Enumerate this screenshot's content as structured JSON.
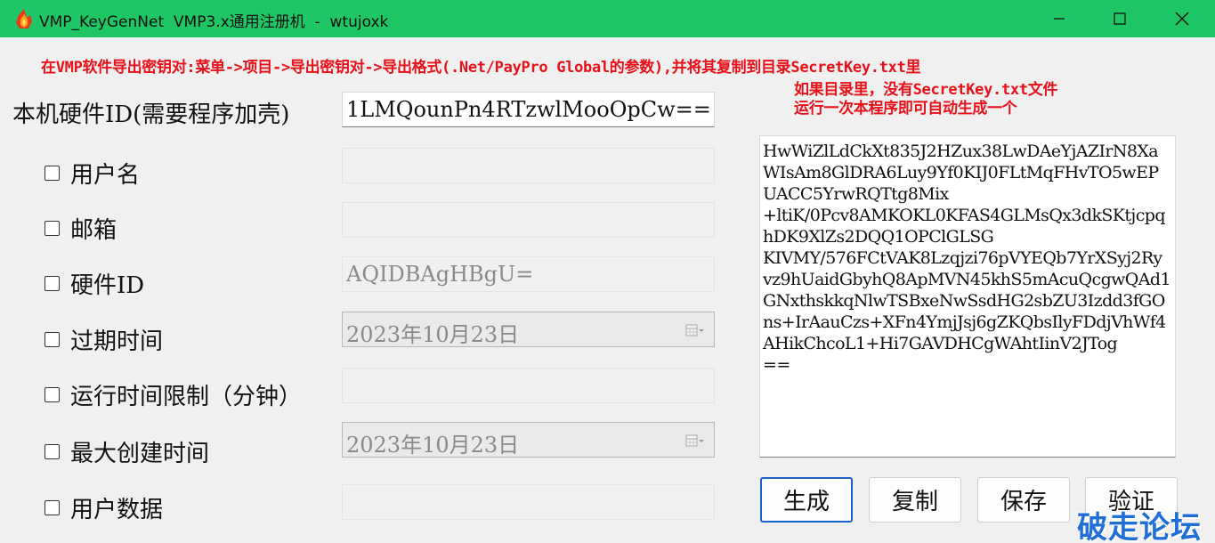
{
  "window": {
    "title": "VMP_KeyGenNet  VMP3.x通用注册机  -  wtujoxk",
    "icon": "flame-logo-icon",
    "title_bar_color": "#1fc666"
  },
  "hints": {
    "top": "在VMP软件导出密钥对:菜单->项目->导出密钥对->导出格式(.Net/PayPro Global的参数),并将其复制到目录SecretKey.txt里",
    "right_line1": "如果目录里，没有SecretKey.txt文件",
    "right_line2": "运行一次本程序即可自动生成一个",
    "color": "#e8101a"
  },
  "hardware": {
    "label": "本机硬件ID(需要程序加壳)",
    "value": "1LMQounPn4RTzwlMooOpCw=="
  },
  "fields": {
    "username": {
      "label": "用户名",
      "value": "",
      "checked": false
    },
    "email": {
      "label": "邮箱",
      "value": "",
      "checked": false
    },
    "hwid": {
      "label": "硬件ID",
      "value": "AQIDBAgHBgU=",
      "checked": false
    },
    "expiry": {
      "label": "过期时间",
      "value": "2023年10月23日",
      "checked": false
    },
    "runtime": {
      "label": "运行时间限制（分钟）",
      "value": "",
      "checked": false
    },
    "maxbuild": {
      "label": "最大创建时间",
      "value": "2023年10月23日",
      "checked": false
    },
    "userdata": {
      "label": "用户数据",
      "value": "",
      "checked": false
    }
  },
  "secret_key": "HwWiZlLdCkXt835J2HZux38LwDAeYjAZIrN8XaWIsAm8GlDRA6Luy9Yf0KIJ0FLtMqFHvTO5wEPUACC5YrwRQTtg8Mix\n+ltiK/0Pcv8AMKOKL0KFAS4GLMsQx3dkSKtjcpqhDK9XlZs2DQQ1OPClGLSG\nKIVMY/576FCtVAK8Lzqjzi76pVYEQb7YrXSyj2Ryvz9hUaidGbyhQ8ApMVN45khS5mAcuQcgwQAd1GNxthskkqNlwTSBxeNwSsdHG2sbZU3Izdd3fGOns+IrAauCzs+XFn4YmjJsj6gZKQbsIlyFDdjVhWf4AHikChcoL1+Hi7GAVDHCgWAhtIinV2JTog\n==",
  "buttons": {
    "generate": "生成",
    "copy": "复制",
    "save": "保存",
    "verify": "验证"
  },
  "watermark": "破走论坛"
}
